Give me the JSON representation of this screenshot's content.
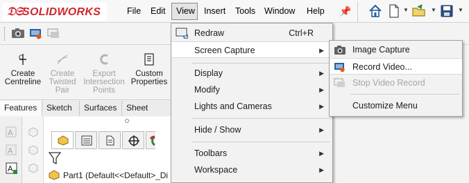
{
  "app": {
    "logo_text": "SOLIDWORKS"
  },
  "menubar": {
    "items": [
      "File",
      "Edit",
      "View",
      "Insert",
      "Tools",
      "Window",
      "Help"
    ]
  },
  "command_manager": {
    "commands": [
      {
        "label": "Create Centreline",
        "lines": [
          "Create",
          "Centreline"
        ],
        "enabled": true,
        "icon": "centreline-icon"
      },
      {
        "label": "Create Twisted Pair",
        "lines": [
          "Create",
          "Twisted",
          "Pair"
        ],
        "enabled": false,
        "icon": "twisted-pair-icon"
      },
      {
        "label": "Export Intersection Points",
        "lines": [
          "Export",
          "Intersection",
          "Points"
        ],
        "enabled": false,
        "icon": "export-points-icon"
      },
      {
        "label": "Custom Properties",
        "lines": [
          "Custom",
          "Properties"
        ],
        "enabled": true,
        "icon": "custom-properties-icon"
      }
    ]
  },
  "tabs": [
    "Features",
    "Sketch",
    "Surfaces",
    "Sheet Metal"
  ],
  "feature_tree": {
    "root": "Part1  (Default<<Default>_Di"
  },
  "view_menu": {
    "items": [
      {
        "label": "Redraw",
        "shortcut": "Ctrl+R",
        "submenu": false,
        "highlighted": false,
        "icon": "redraw-icon"
      },
      {
        "label": "Screen Capture",
        "shortcut": "",
        "submenu": true,
        "highlighted": true
      },
      {
        "label": "Display",
        "shortcut": "",
        "submenu": true,
        "highlighted": false
      },
      {
        "label": "Modify",
        "shortcut": "",
        "submenu": true,
        "highlighted": false
      },
      {
        "label": "Lights and Cameras",
        "shortcut": "",
        "submenu": true,
        "highlighted": false
      },
      {
        "label": "Hide / Show",
        "shortcut": "",
        "submenu": true,
        "highlighted": false
      },
      {
        "label": "Toolbars",
        "shortcut": "",
        "submenu": true,
        "highlighted": false
      },
      {
        "label": "Workspace",
        "shortcut": "",
        "submenu": true,
        "highlighted": false
      }
    ]
  },
  "screen_capture_submenu": {
    "items": [
      {
        "label": "Image Capture",
        "enabled": true,
        "highlighted": false,
        "icon": "camera-icon"
      },
      {
        "label": "Record Video...",
        "enabled": true,
        "highlighted": true,
        "icon": "record-video-icon"
      },
      {
        "label": "Stop Video Record",
        "enabled": false,
        "highlighted": false,
        "icon": "stop-video-icon"
      },
      {
        "label": "Customize Menu",
        "enabled": true,
        "highlighted": false
      }
    ]
  },
  "colors": {
    "brand": "#d22630",
    "accent": "#1f6fb5",
    "record": "#e05a1e"
  }
}
